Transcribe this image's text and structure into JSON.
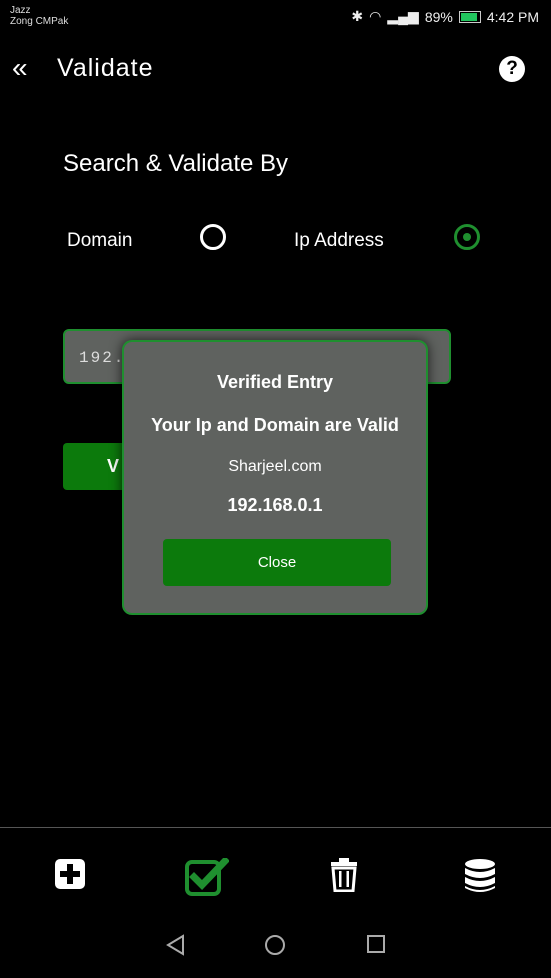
{
  "status_bar": {
    "carrier_line1": "Jazz",
    "carrier_line2": "Zong CMPak",
    "battery_percent": "89%",
    "time": "4:42 PM"
  },
  "header": {
    "title": "Validate",
    "back_icon": "double-chevron-left-icon",
    "help_icon": "question-circle-icon"
  },
  "form": {
    "section_title": "Search & Validate By",
    "options": [
      {
        "label": "Domain",
        "selected": false
      },
      {
        "label": "Ip Address",
        "selected": true
      }
    ],
    "ip_value": "192.1",
    "validate_label": "V"
  },
  "dialog": {
    "title": "Verified Entry",
    "message": "Your Ip and Domain are Valid",
    "domain": "Sharjeel.com",
    "ip": "192.168.0.1",
    "close_label": "Close"
  },
  "bottom_nav": {
    "items": [
      "add-icon",
      "validate-checkbox-icon",
      "trash-icon",
      "database-icon"
    ],
    "active": "validate-checkbox-icon",
    "accent_color": "#1f8f2f"
  },
  "system_nav": [
    "back-triangle-icon",
    "home-circle-icon",
    "recents-square-icon"
  ]
}
